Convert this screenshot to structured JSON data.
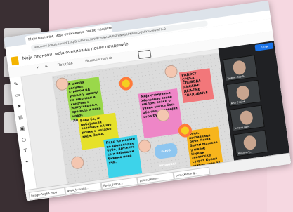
{
  "browser": {
    "tab_title": "Моји планови, моја очекивања после пандемије",
    "url": "jamboard.google.com/d/1TKpBnLi8kDGcXCW8c2p9VwMfBSFHNHjbLPNSWcOQS8Kz/viewer?f=2"
  },
  "app": {
    "board_title": "Моји планови, моја очекивања после пандемије",
    "toolbar": {
      "undo_label": "",
      "redo_label": "",
      "clear_label": "Поздрав",
      "reset_label": "Испиши пално",
      "page_label": "1/1"
    },
    "invite_label": "Дели"
  },
  "notes": {
    "green": "А школа насупот, страхом од учења у школу на школски а коначно и једну недеље, пре моје и чека новост Додоријав.",
    "yellow": "Боба бе, ш небојивели чевичари од ше дооке и незаже мојм. Заље.",
    "cyan": "Радо ће мозете по Шоколадне бубе, дружите се и најлошии бићемо нове учи.",
    "pink": "Моја очекувања Жоновиле свиве шклом, свако о учене свежа бош обе свеј коловојни игра бусај.",
    "red": "РАДОСТ, СРЕЋА, СЛОБОДА ДИСАЊЕ ДЕЉЕМЕ ГЛАДОВАЊЕ",
    "orange": "Деца, наставници речи Меша Затим Мажеле у шкем; Наједи законоске сусрет Корил шибло нове за сада, извиње.",
    "good_morning": "GOOD MORNING!"
  },
  "participants": [
    {
      "name": "Ђорђе Лазић"
    },
    {
      "name": "Ана Стајић"
    },
    {
      "name": "Јелена Дић"
    },
    {
      "name": "Никола Ђ."
    }
  ],
  "downloads": [
    {
      "name": "Image-Rog6Ä.mp4"
    },
    {
      "name": "goza_tr-rvaga..."
    },
    {
      "name": "Ppoja_jadna..."
    },
    {
      "name": "ppoja_jadna..."
    },
    {
      "name": "pesu_klasang..."
    }
  ],
  "colors": {
    "green": "#9ad84a",
    "yellow": "#e6e12a",
    "cyan": "#3dd3ea",
    "pink": "#ee86c7",
    "red": "#f2777a",
    "orange": "#f7b51c"
  }
}
